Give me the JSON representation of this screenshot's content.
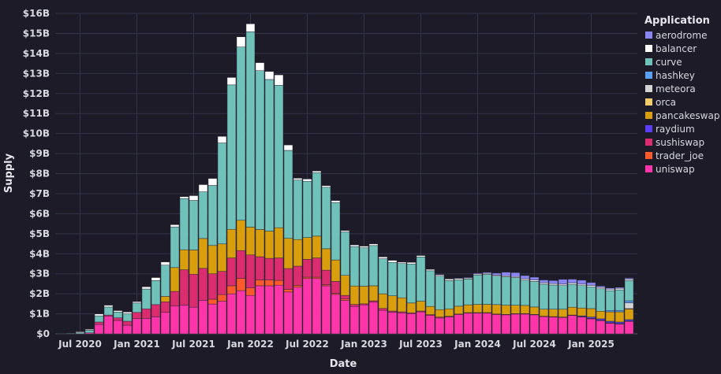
{
  "chart_data": {
    "type": "bar",
    "stacked": true,
    "xlabel": "Date",
    "ylabel": "Supply",
    "ylim": [
      0,
      16
    ],
    "y_ticks": [
      "$0",
      "$1B",
      "$2B",
      "$3B",
      "$4B",
      "$5B",
      "$6B",
      "$7B",
      "$8B",
      "$9B",
      "$10B",
      "$11B",
      "$12B",
      "$13B",
      "$14B",
      "$15B",
      "$16B"
    ],
    "x_ticks": [
      {
        "label": "Jul 2020",
        "index": 2
      },
      {
        "label": "Jan 2021",
        "index": 8
      },
      {
        "label": "Jul 2021",
        "index": 14
      },
      {
        "label": "Jan 2022",
        "index": 20
      },
      {
        "label": "Jul 2022",
        "index": 26
      },
      {
        "label": "Jan 2023",
        "index": 32
      },
      {
        "label": "Jul 2023",
        "index": 38
      },
      {
        "label": "Jan 2024",
        "index": 44
      },
      {
        "label": "Jul 2024",
        "index": 50
      },
      {
        "label": "Jan 2025",
        "index": 56
      }
    ],
    "categories": [
      "May 2020",
      "Jun 2020",
      "Jul 2020",
      "Aug 2020",
      "Sep 2020",
      "Oct 2020",
      "Nov 2020",
      "Dec 2020",
      "Jan 2021",
      "Feb 2021",
      "Mar 2021",
      "Apr 2021",
      "May 2021",
      "Jun 2021",
      "Jul 2021",
      "Aug 2021",
      "Sep 2021",
      "Oct 2021",
      "Nov 2021",
      "Dec 2021",
      "Jan 2022",
      "Feb 2022",
      "Mar 2022",
      "Apr 2022",
      "May 2022",
      "Jun 2022",
      "Jul 2022",
      "Aug 2022",
      "Sep 2022",
      "Oct 2022",
      "Nov 2022",
      "Dec 2022",
      "Jan 2023",
      "Feb 2023",
      "Mar 2023",
      "Apr 2023",
      "May 2023",
      "Jun 2023",
      "Jul 2023",
      "Aug 2023",
      "Sep 2023",
      "Oct 2023",
      "Nov 2023",
      "Dec 2023",
      "Jan 2024",
      "Feb 2024",
      "Mar 2024",
      "Apr 2024",
      "May 2024",
      "Jun 2024",
      "Jul 2024",
      "Aug 2024",
      "Sep 2024",
      "Oct 2024",
      "Nov 2024",
      "Dec 2024",
      "Jan 2025",
      "Feb 2025",
      "Mar 2025",
      "Apr 2025",
      "May 2025"
    ],
    "unit": "USD billions",
    "legend": {
      "title": "Application",
      "placement": "right"
    },
    "series": [
      {
        "name": "aerodrome",
        "color": "#8a86f2",
        "values": [
          0,
          0,
          0,
          0,
          0,
          0,
          0,
          0,
          0,
          0,
          0,
          0,
          0,
          0,
          0,
          0,
          0,
          0,
          0,
          0,
          0,
          0,
          0,
          0,
          0,
          0,
          0,
          0,
          0,
          0,
          0,
          0,
          0,
          0,
          0,
          0,
          0,
          0,
          0,
          0,
          0.02,
          0.02,
          0.02,
          0.03,
          0.04,
          0.05,
          0.1,
          0.18,
          0.2,
          0.16,
          0.14,
          0.14,
          0.15,
          0.24,
          0.19,
          0.2,
          0.14,
          0.07,
          0.06,
          0.05,
          0.06
        ]
      },
      {
        "name": "balancer",
        "color": "#ffffff",
        "values": [
          0,
          0,
          0.05,
          0.05,
          0.09,
          0.09,
          0.07,
          0.09,
          0.07,
          0.11,
          0.15,
          0.16,
          0.11,
          0.09,
          0.24,
          0.36,
          0.35,
          0.33,
          0.37,
          0.51,
          0.4,
          0.4,
          0.4,
          0.52,
          0.27,
          0.09,
          0.11,
          0.08,
          0.08,
          0.09,
          0.07,
          0.08,
          0.08,
          0.08,
          0.09,
          0.1,
          0.07,
          0.08,
          0.07,
          0.07,
          0.07,
          0.08,
          0.07,
          0.05,
          0.05,
          0.05,
          0.05,
          0.05,
          0.05,
          0.07,
          0.07,
          0.07,
          0.07,
          0.07,
          0.07,
          0.07,
          0.07,
          0.07,
          0.07,
          0.07,
          0.07
        ]
      },
      {
        "name": "curve",
        "color": "#6fc1b9",
        "values": [
          0.02,
          0.03,
          0.05,
          0.13,
          0.31,
          0.4,
          0.29,
          0.37,
          0.47,
          0.99,
          1.2,
          1.56,
          2.03,
          2.56,
          2.47,
          2.33,
          3.0,
          5.04,
          7.21,
          8.65,
          9.75,
          7.93,
          7.57,
          7.11,
          4.39,
          2.97,
          2.81,
          3.17,
          3.07,
          2.87,
          2.17,
          1.97,
          1.92,
          2.01,
          1.75,
          1.67,
          1.71,
          1.95,
          2.21,
          1.78,
          1.67,
          1.41,
          1.32,
          1.29,
          1.47,
          1.5,
          1.42,
          1.42,
          1.38,
          1.26,
          1.28,
          1.25,
          1.21,
          1.18,
          1.14,
          1.12,
          1.09,
          1.12,
          0.99,
          1.03,
          1.01
        ]
      },
      {
        "name": "hashkey",
        "color": "#5aa0f5",
        "values": [
          0,
          0,
          0,
          0,
          0,
          0,
          0,
          0,
          0,
          0,
          0,
          0,
          0,
          0,
          0,
          0,
          0,
          0,
          0,
          0,
          0,
          0,
          0,
          0,
          0,
          0,
          0,
          0,
          0,
          0,
          0,
          0,
          0,
          0,
          0,
          0,
          0,
          0,
          0,
          0,
          0,
          0,
          0,
          0,
          0,
          0,
          0,
          0,
          0,
          0,
          0,
          0,
          0,
          0,
          0,
          0,
          0,
          0,
          0.07,
          0.07,
          0.1
        ]
      },
      {
        "name": "meteora",
        "color": "#d4d4d4",
        "values": [
          0,
          0,
          0,
          0,
          0,
          0,
          0,
          0,
          0,
          0,
          0,
          0,
          0,
          0,
          0,
          0,
          0,
          0,
          0,
          0,
          0,
          0,
          0,
          0,
          0,
          0,
          0,
          0,
          0,
          0,
          0,
          0,
          0,
          0,
          0,
          0,
          0,
          0,
          0,
          0,
          0,
          0,
          0,
          0,
          0,
          0,
          0,
          0,
          0,
          0,
          0,
          0,
          0,
          0,
          0,
          0,
          0,
          0,
          0,
          0,
          0.29
        ]
      },
      {
        "name": "orca",
        "color": "#f2cc6a",
        "values": [
          0,
          0,
          0,
          0,
          0,
          0,
          0,
          0,
          0,
          0,
          0,
          0,
          0,
          0,
          0,
          0,
          0,
          0,
          0,
          0,
          0,
          0,
          0,
          0,
          0,
          0,
          0,
          0,
          0,
          0,
          0,
          0,
          0,
          0,
          0,
          0,
          0,
          0,
          0,
          0,
          0,
          0,
          0,
          0,
          0,
          0,
          0,
          0,
          0,
          0,
          0,
          0,
          0,
          0,
          0,
          0,
          0,
          0,
          0,
          0,
          0.02
        ]
      },
      {
        "name": "pancakeswap",
        "color": "#d99e0b",
        "values": [
          0,
          0,
          0,
          0,
          0,
          0,
          0,
          0,
          0,
          0,
          0,
          0.27,
          1.19,
          1.0,
          1.21,
          1.49,
          1.41,
          1.37,
          1.43,
          1.51,
          1.39,
          1.36,
          1.36,
          1.51,
          1.51,
          1.33,
          1.09,
          1.09,
          1.07,
          1.07,
          1.0,
          0.92,
          0.88,
          0.75,
          0.73,
          0.76,
          0.7,
          0.49,
          0.49,
          0.41,
          0.37,
          0.37,
          0.39,
          0.39,
          0.41,
          0.41,
          0.47,
          0.46,
          0.42,
          0.41,
          0.37,
          0.35,
          0.37,
          0.39,
          0.39,
          0.39,
          0.42,
          0.38,
          0.47,
          0.51,
          0.53
        ]
      },
      {
        "name": "raydium",
        "color": "#5b3ef5",
        "values": [
          0,
          0,
          0,
          0,
          0,
          0,
          0,
          0,
          0,
          0,
          0,
          0,
          0,
          0,
          0,
          0,
          0,
          0,
          0,
          0,
          0,
          0,
          0,
          0,
          0,
          0,
          0,
          0,
          0,
          0,
          0,
          0,
          0,
          0,
          0,
          0,
          0,
          0,
          0,
          0,
          0,
          0,
          0,
          0,
          0,
          0,
          0,
          0,
          0,
          0,
          0,
          0,
          0,
          0,
          0,
          0.04,
          0.07,
          0.07,
          0.08,
          0.08,
          0.07
        ]
      },
      {
        "name": "sushiswap",
        "color": "#da2c6f",
        "values": [
          0,
          0,
          0,
          0,
          0.12,
          0.05,
          0.13,
          0.2,
          0.31,
          0.49,
          0.61,
          0.53,
          0.73,
          1.77,
          1.65,
          1.6,
          1.27,
          1.16,
          1.39,
          1.39,
          1.65,
          1.16,
          1.08,
          1.12,
          1.04,
          0.96,
          0.89,
          0.96,
          0.73,
          0.6,
          0.18,
          0.1,
          0.05,
          0.07,
          0.09,
          0.06,
          0.05,
          0.04,
          0.04,
          0.04,
          0.05,
          0.04,
          0.02,
          0.02,
          0.02,
          0.02,
          0.02,
          0.02,
          0.02,
          0.02,
          0.02,
          0.02,
          0.02,
          0.02,
          0.02,
          0.02,
          0.02,
          0.02,
          0.02,
          0.02,
          0.02
        ]
      },
      {
        "name": "trader_joe",
        "color": "#ff5a2c",
        "values": [
          0,
          0,
          0,
          0,
          0,
          0,
          0,
          0,
          0,
          0,
          0,
          0,
          0,
          0,
          0,
          0,
          0.24,
          0.33,
          0.4,
          0.61,
          0.37,
          0.29,
          0.29,
          0.24,
          0.13,
          0.09,
          0.07,
          0.07,
          0.05,
          0.05,
          0.07,
          0,
          0,
          0,
          0,
          0,
          0,
          0,
          0,
          0,
          0,
          0,
          0,
          0,
          0,
          0,
          0,
          0,
          0,
          0,
          0,
          0,
          0,
          0,
          0,
          0,
          0,
          0,
          0,
          0,
          0
        ]
      },
      {
        "name": "uniswap",
        "color": "#ff35a9",
        "values": [
          0,
          0,
          0,
          0.05,
          0.47,
          0.89,
          0.67,
          0.43,
          0.76,
          0.76,
          0.85,
          1.07,
          1.39,
          1.43,
          1.33,
          1.67,
          1.49,
          1.63,
          2.0,
          2.16,
          1.92,
          2.4,
          2.4,
          2.43,
          2.09,
          2.33,
          2.76,
          2.76,
          2.4,
          1.97,
          1.67,
          1.37,
          1.45,
          1.58,
          1.18,
          1.08,
          1.05,
          1.01,
          1.1,
          0.92,
          0.79,
          0.84,
          0.97,
          1.04,
          1.04,
          1.04,
          0.97,
          0.95,
          0.99,
          0.99,
          0.95,
          0.86,
          0.84,
          0.82,
          0.92,
          0.84,
          0.75,
          0.66,
          0.53,
          0.49,
          0.62
        ]
      }
    ],
    "stack_order_bottom_to_top": [
      "uniswap",
      "trader_joe",
      "sushiswap",
      "raydium",
      "pancakeswap",
      "orca",
      "meteora",
      "hashkey",
      "curve",
      "balancer",
      "aerodrome"
    ]
  }
}
